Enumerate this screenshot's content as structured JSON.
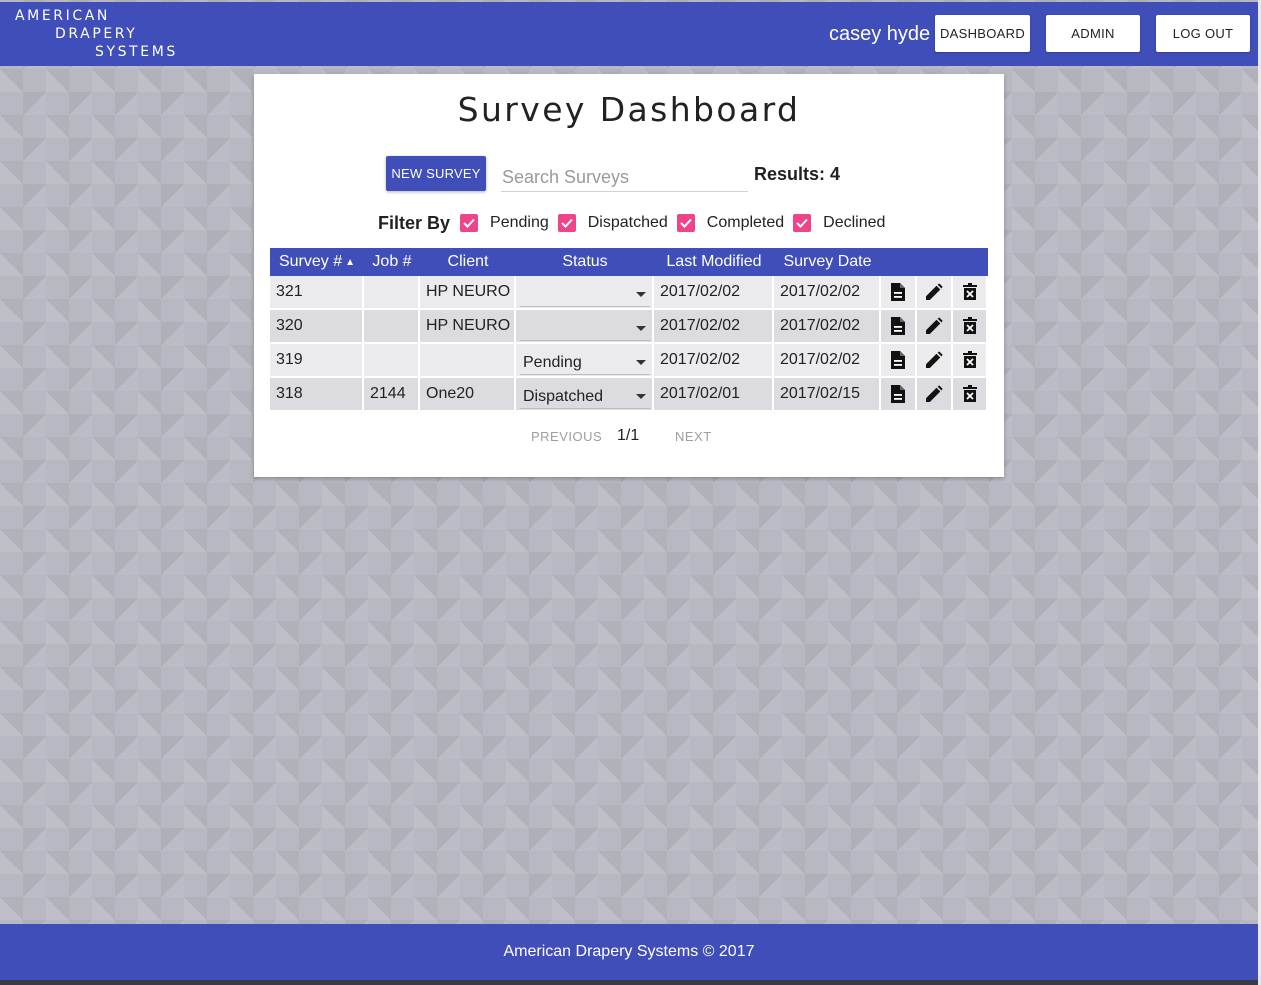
{
  "header": {
    "logo_lines": [
      "AMERICAN",
      "DRAPERY",
      "SYSTEMS"
    ],
    "user_name": "casey hyde",
    "nav": {
      "dashboard": "DASHBOARD",
      "admin": "ADMIN",
      "logout": "LOG OUT"
    }
  },
  "main": {
    "title": "Survey Dashboard",
    "new_survey_label": "NEW SURVEY",
    "search": {
      "placeholder": "Search Surveys",
      "value": ""
    },
    "results": "Results: 4",
    "filter": {
      "label": "Filter By",
      "options": [
        {
          "label": "Pending",
          "checked": true
        },
        {
          "label": "Dispatched",
          "checked": true
        },
        {
          "label": "Completed",
          "checked": true
        },
        {
          "label": "Declined",
          "checked": true
        }
      ]
    },
    "table": {
      "columns": [
        "Survey #",
        "Job #",
        "Client",
        "Status",
        "Last Modified",
        "Survey Date"
      ],
      "sort_indicator": "▲",
      "rows": [
        {
          "survey": "321",
          "job": "",
          "client": "HP NEURO",
          "status": "",
          "modified": "2017/02/02",
          "date": "2017/02/02"
        },
        {
          "survey": "320",
          "job": "",
          "client": "HP NEURO",
          "status": "",
          "modified": "2017/02/02",
          "date": "2017/02/02"
        },
        {
          "survey": "319",
          "job": "",
          "client": "",
          "status": "Pending",
          "modified": "2017/02/02",
          "date": "2017/02/02"
        },
        {
          "survey": "318",
          "job": "2144",
          "client": "One20",
          "status": "Dispatched",
          "modified": "2017/02/01",
          "date": "2017/02/15"
        }
      ],
      "row_icons": [
        "document-icon",
        "pencil-icon",
        "trash-icon"
      ]
    },
    "pager": {
      "previous": "PREVIOUS",
      "page": "1/1",
      "next": "NEXT"
    }
  },
  "footer": {
    "text": "American Drapery Systems © 2017"
  },
  "colors": {
    "primary": "#3f4eb8",
    "checkbox": "#f0448a"
  }
}
